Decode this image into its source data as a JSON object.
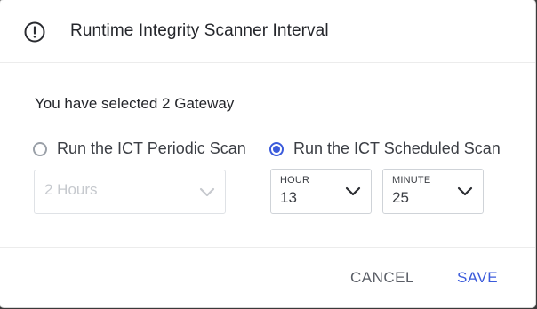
{
  "dialog": {
    "title": "Runtime Integrity Scanner Interval",
    "icon": "alert-circle-icon"
  },
  "body": {
    "selected_text": "You have selected 2 Gateway",
    "periodic": {
      "label": "Run the ICT Periodic Scan",
      "checked": false,
      "interval_value": "2 Hours",
      "interval_disabled": true
    },
    "scheduled": {
      "label": "Run the ICT Scheduled Scan",
      "checked": true,
      "hour_caption": "HOUR",
      "hour_value": "13",
      "minute_caption": "MINUTE",
      "minute_value": "25"
    }
  },
  "footer": {
    "cancel_label": "CANCEL",
    "save_label": "SAVE"
  },
  "colors": {
    "accent": "#3b5bdb",
    "text": "#24262b",
    "muted": "#5a5e66",
    "disabled": "#c6c9ce"
  }
}
